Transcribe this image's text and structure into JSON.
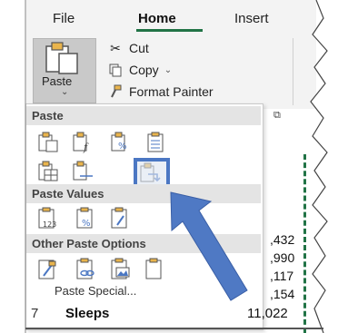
{
  "ribbon": {
    "tabs": [
      {
        "label": "File"
      },
      {
        "label": "Home"
      },
      {
        "label": "Insert"
      }
    ],
    "active_tab": "Home",
    "paste_button_label": "Paste",
    "clipboard": {
      "cut_label": "Cut",
      "copy_label": "Copy",
      "format_painter_label": "Format Painter"
    }
  },
  "paste_menu": {
    "sections": [
      {
        "title": "Paste"
      },
      {
        "title": "Paste Values"
      },
      {
        "title": "Other Paste Options"
      }
    ],
    "paste_special_label": "Paste Special...",
    "highlighted_option": "transpose-icon"
  },
  "sheet": {
    "values": [
      ",432",
      ",990",
      ",117",
      ",154"
    ],
    "row_number": "7",
    "row_label": "Sleeps",
    "row_value": "11,022"
  },
  "colors": {
    "accent_green": "#217346",
    "highlight_blue": "#4b77c3",
    "arrow_blue": "#4f79c4"
  }
}
